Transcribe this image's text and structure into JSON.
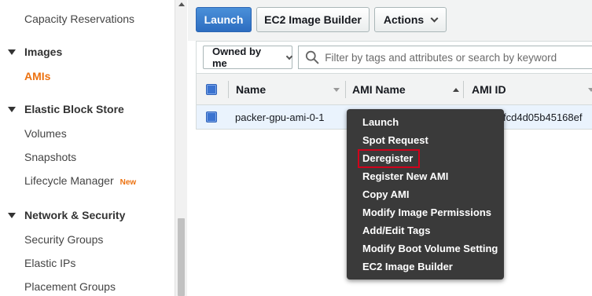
{
  "sidebar": {
    "items_top": {
      "capacity_reservations": "Capacity Reservations"
    },
    "images_section": {
      "title": "Images",
      "amis": "AMIs"
    },
    "ebs_section": {
      "title": "Elastic Block Store",
      "volumes": "Volumes",
      "snapshots": "Snapshots",
      "lifecycle_manager": "Lifecycle Manager",
      "new_badge": "New"
    },
    "network_section": {
      "title": "Network & Security",
      "security_groups": "Security Groups",
      "elastic_ips": "Elastic IPs",
      "placement_groups": "Placement Groups"
    }
  },
  "toolbar": {
    "launch_label": "Launch",
    "ec2_image_builder_label": "EC2 Image Builder",
    "actions_label": "Actions"
  },
  "filter": {
    "owned_by": "Owned by me",
    "search_placeholder": "Filter by tags and attributes or search by keyword"
  },
  "table": {
    "columns": {
      "name": "Name",
      "ami_name": "AMI Name",
      "ami_id": "AMI ID"
    },
    "rows": [
      {
        "name": "packer-gpu-ami-0-1",
        "ami_id_visible": "fcd4d05b45168ef"
      }
    ]
  },
  "context_menu": {
    "items": [
      "Launch",
      "Spot Request",
      "Deregister",
      "Register New AMI",
      "Copy AMI",
      "Modify Image Permissions",
      "Add/Edit Tags",
      "Modify Boot Volume Setting",
      "EC2 Image Builder"
    ],
    "highlighted_item": "Deregister",
    "highlight_color": "#d0021b"
  },
  "colors": {
    "accent_orange": "#ec7211",
    "primary_blue": "#2d6dc0",
    "menu_bg": "#3a3a3a",
    "selected_row_bg": "#eaf3fd"
  },
  "icons": {
    "search": "search-icon",
    "section_caret": "caret-down-icon",
    "dropdown": "chevron-down-icon"
  }
}
